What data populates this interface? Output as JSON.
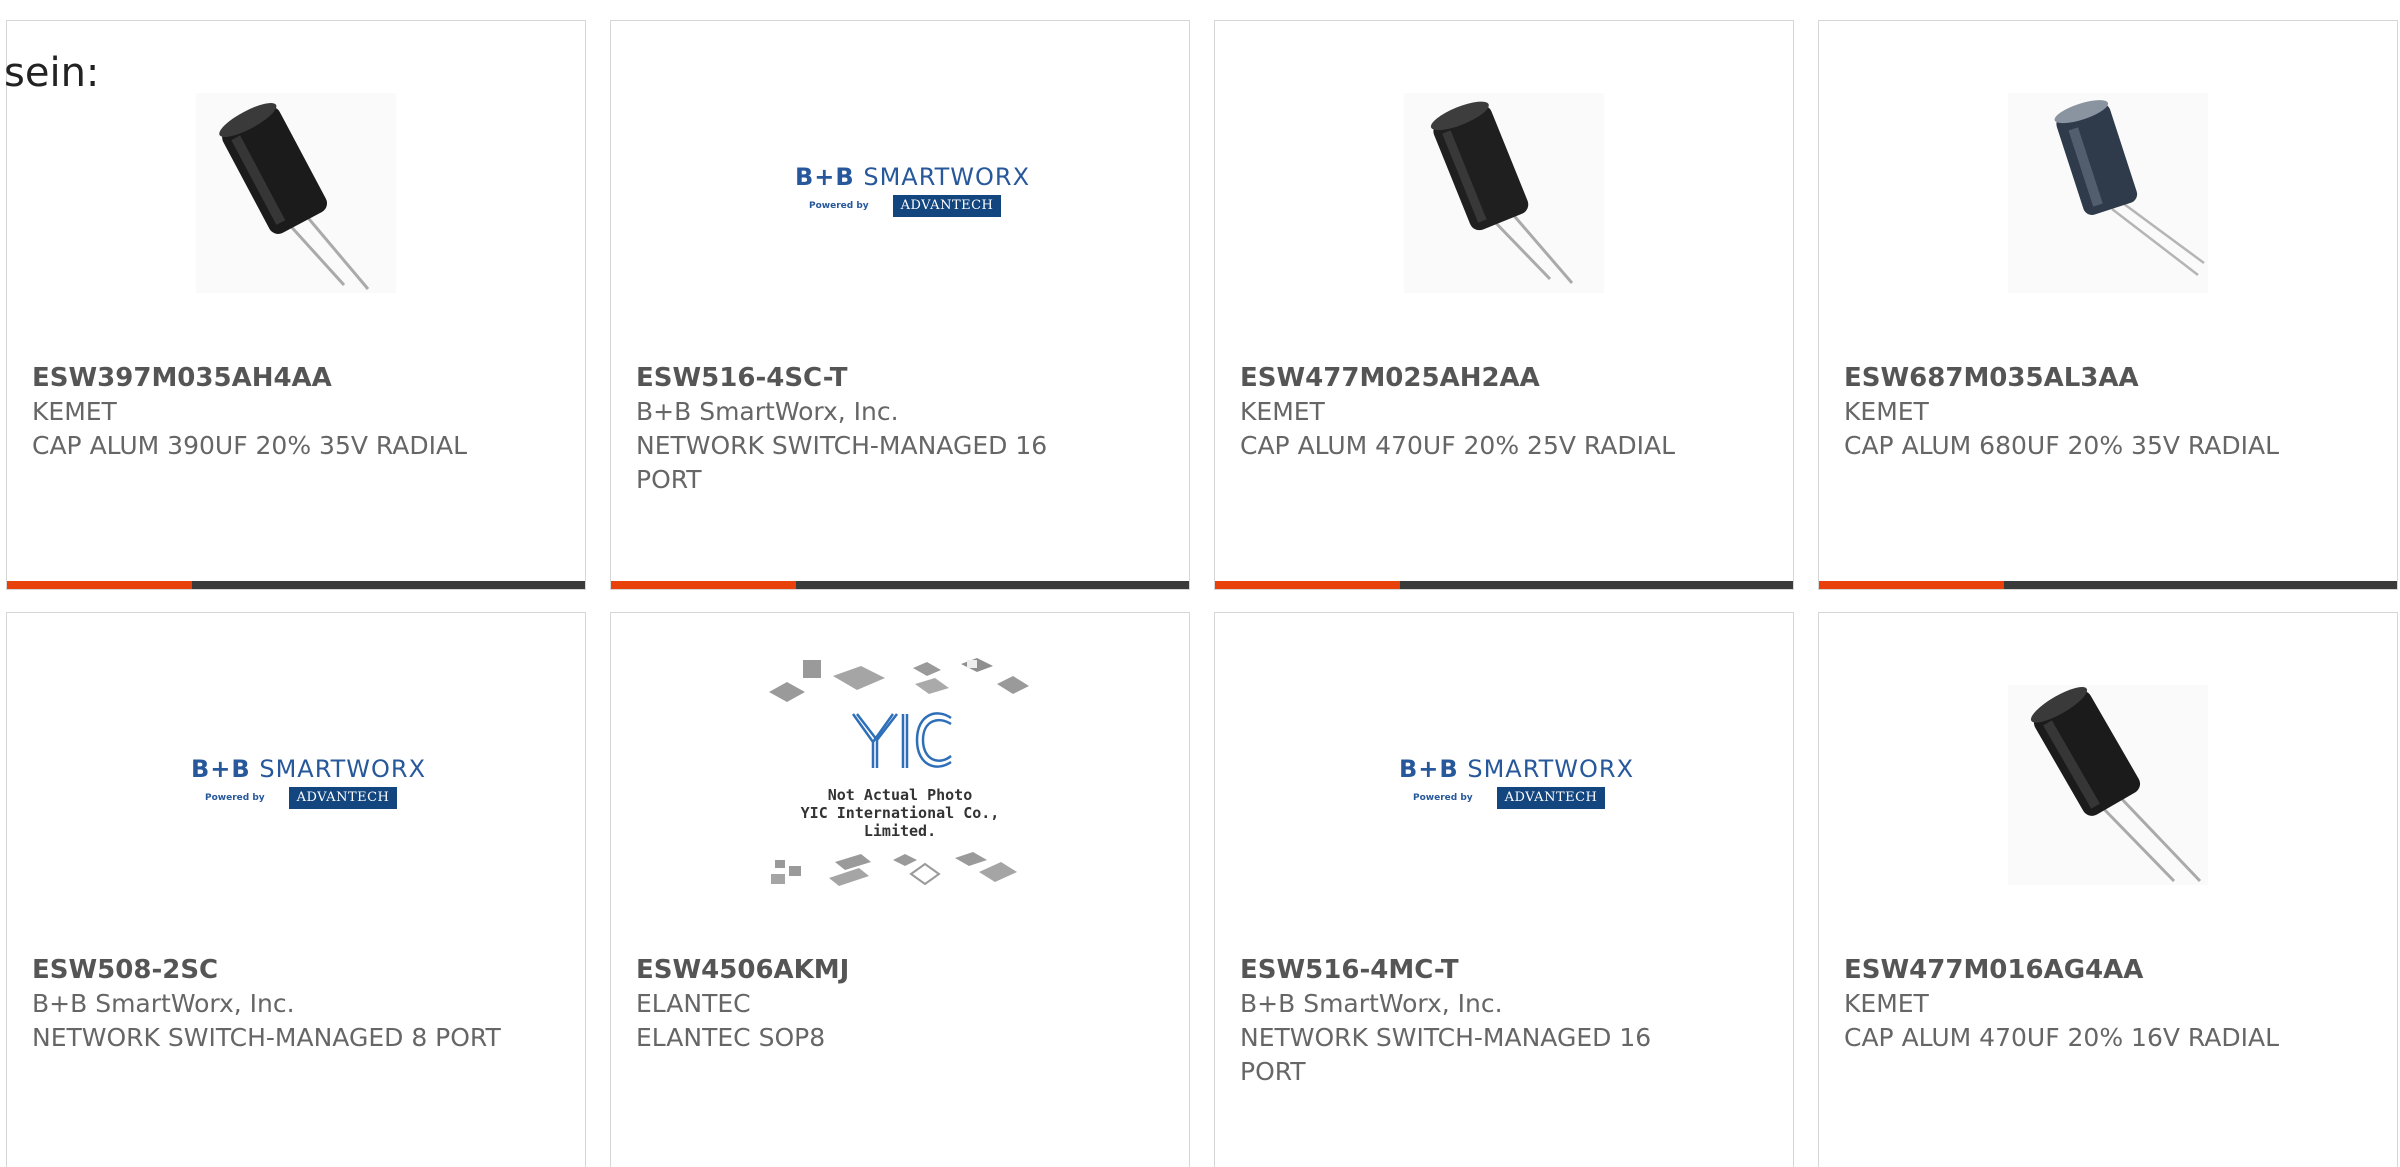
{
  "leadin": "sein:",
  "colors": {
    "accent": "#e8410b",
    "bar": "#3a3a3a",
    "border": "#d6d6d6",
    "logo_blue": "#27589b"
  },
  "products": [
    {
      "part_number": "ESW397M035AH4AA",
      "manufacturer": "KEMET",
      "description": "CAP ALUM 390UF 20% 35V RADIAL",
      "image": "capacitor-icon",
      "progress": 0.32
    },
    {
      "part_number": "ESW516-4SC-T",
      "manufacturer": "B+B SmartWorx, Inc.",
      "description": "NETWORK SWITCH-MANAGED 16 PORT",
      "image": "bb-smartworx-logo",
      "progress": 0.32
    },
    {
      "part_number": "ESW477M025AH2AA",
      "manufacturer": "KEMET",
      "description": "CAP ALUM 470UF 20% 25V RADIAL",
      "image": "capacitor-icon",
      "progress": 0.32
    },
    {
      "part_number": "ESW687M035AL3AA",
      "manufacturer": "KEMET",
      "description": "CAP ALUM 680UF 20% 35V RADIAL",
      "image": "capacitor-icon",
      "progress": 0.32
    },
    {
      "part_number": "ESW508-2SC",
      "manufacturer": "B+B SmartWorx, Inc.",
      "description": "NETWORK SWITCH-MANAGED 8 PORT",
      "image": "bb-smartworx-logo"
    },
    {
      "part_number": "ESW4506AKMJ",
      "manufacturer": "ELANTEC",
      "description": "ELANTEC SOP8",
      "image": "yic-placeholder"
    },
    {
      "part_number": "ESW516-4MC-T",
      "manufacturer": "B+B SmartWorx, Inc.",
      "description": "NETWORK SWITCH-MANAGED 16 PORT",
      "image": "bb-smartworx-logo"
    },
    {
      "part_number": "ESW477M016AG4AA",
      "manufacturer": "KEMET",
      "description": "CAP ALUM 470UF 20% 16V RADIAL",
      "image": "capacitor-icon"
    }
  ],
  "logos": {
    "bb_brand": "B+B SMARTWORX",
    "bb_powered": "Powered by",
    "bb_advantech": "ADVANTECH",
    "yic_mark": "YIC",
    "yic_note_line1": "Not Actual Photo",
    "yic_note_line2": "YIC International Co., Limited."
  }
}
